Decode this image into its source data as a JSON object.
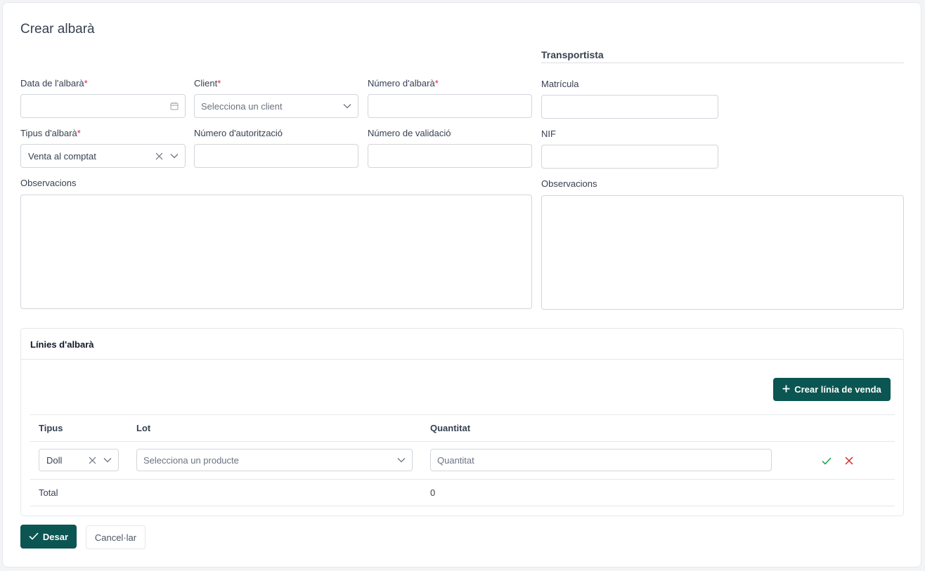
{
  "page": {
    "title": "Crear albarà"
  },
  "form": {
    "date_label": "Data de l'albarà",
    "client_label": "Client",
    "client_placeholder": "Selecciona un client",
    "number_label": "Número d'albarà",
    "type_label": "Tipus d'albarà",
    "type_value": "Venta al comptat",
    "auth_label": "Número d'autorització",
    "validation_label": "Número de validació",
    "observations_label": "Observacions",
    "required_mark": "*"
  },
  "transport": {
    "title": "Transportista",
    "plate_label": "Matrícula",
    "nif_label": "NIF",
    "observations_label": "Observacions"
  },
  "lines": {
    "title": "Línies d'albarà",
    "create_button": "Crear línia de venda",
    "columns": [
      "Tipus",
      "Lot",
      "Quantitat"
    ],
    "row": {
      "type_value": "Doll",
      "lot_placeholder": "Selecciona un producte",
      "quantity_placeholder": "Quantitat"
    },
    "total_label": "Total",
    "total_value": "0"
  },
  "footer": {
    "save_label": "Desar",
    "cancel_label": "Cancel·lar"
  },
  "colors": {
    "primary": "#0b5552",
    "required": "#e11d48",
    "confirm": "#16a34a",
    "cancel": "#dc2626"
  }
}
